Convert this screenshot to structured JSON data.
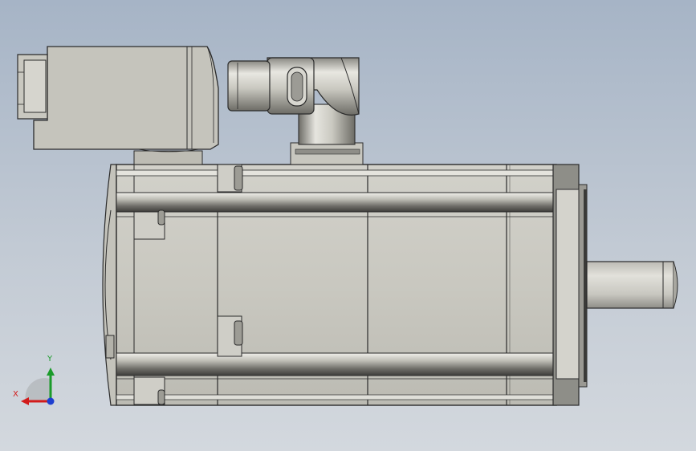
{
  "viewport": {
    "background_top": "#a6b4c6",
    "background_bottom": "#d3d8de"
  },
  "model": {
    "description_icon": "servo-motor-side-view",
    "body_color": "#c6c5bd",
    "edge_color": "#2b2b2b",
    "flange_color": "#8e8e88"
  },
  "triad": {
    "x_label": "X",
    "y_label": "Y",
    "x_color": "#d21b1b",
    "y_color": "#1a9b2a",
    "z_color": "#1e3fd0"
  }
}
